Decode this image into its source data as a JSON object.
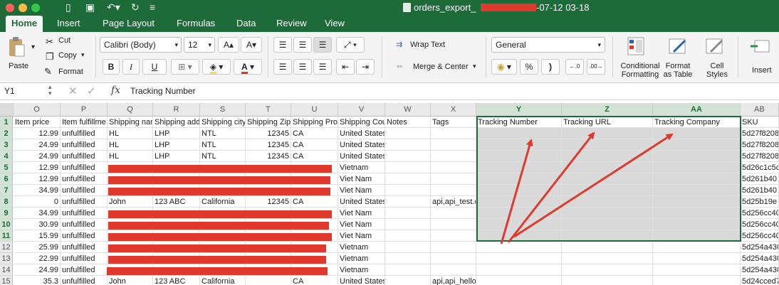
{
  "window": {
    "title": "orders_export_",
    "title_suffix": "-07-12 03-18"
  },
  "ribbon_tabs": [
    "Home",
    "Insert",
    "Page Layout",
    "Formulas",
    "Data",
    "Review",
    "View"
  ],
  "ribbon": {
    "paste": "Paste",
    "cut": "Cut",
    "copy": "Copy",
    "format": "Format",
    "font": "Calibri (Body)",
    "size": "12",
    "bold": "B",
    "italic": "I",
    "underline": "U",
    "wrap": "Wrap Text",
    "merge": "Merge & Center",
    "numformat": "General",
    "percent": "%",
    "comma": ")",
    "cond1": "Conditional",
    "cond2": "Formatting",
    "fmt1": "Format",
    "fmt2": "as Table",
    "cell1": "Cell",
    "cell2": "Styles",
    "insert": "Insert"
  },
  "formula": {
    "name": "Y1",
    "fx": "fx",
    "value": "Tracking Number"
  },
  "columns": [
    "O",
    "P",
    "Q",
    "R",
    "S",
    "T",
    "U",
    "V",
    "W",
    "X",
    "Y",
    "Z",
    "AA",
    "AB"
  ],
  "rows": [
    "1",
    "2",
    "3",
    "4",
    "5",
    "6",
    "7",
    "8",
    "9",
    "10",
    "11",
    "12",
    "13",
    "14",
    "15"
  ],
  "headers": [
    "Item price",
    "Item fulfillme",
    "Shipping nan",
    "Shipping add",
    "Shipping city",
    "Shipping Zip",
    "Shipping Pro",
    "Shipping Cou",
    "Notes",
    "Tags",
    "Tracking Number",
    "Tracking URL",
    "Tracking Company",
    "SKU"
  ],
  "table_rows": [
    [
      "12.99",
      "unfulfilled",
      "HL",
      "LHP",
      "NTL",
      "12345",
      "CA",
      "United States",
      "",
      "",
      "5d27f8208"
    ],
    [
      "24.99",
      "unfulfilled",
      "HL",
      "LHP",
      "NTL",
      "12345",
      "CA",
      "United States",
      "",
      "",
      "5d27f8208"
    ],
    [
      "24.99",
      "unfulfilled",
      "HL",
      "LHP",
      "NTL",
      "12345",
      "CA",
      "United States",
      "",
      "",
      "5d27f8208"
    ],
    [
      "12.99",
      "unfulfilled",
      "",
      "",
      "",
      "",
      "",
      "Vietnam",
      "",
      "",
      "5d26c1c5c"
    ],
    [
      "12.99",
      "unfulfilled",
      "",
      "",
      "",
      "",
      "",
      "Viet Nam",
      "",
      "",
      "5d261b40"
    ],
    [
      "34.99",
      "unfulfilled",
      "",
      "",
      "",
      "",
      "",
      "Viet Nam",
      "",
      "",
      "5d261b40"
    ],
    [
      "0",
      "unfulfilled",
      "John",
      "123 ABC",
      "California",
      "12345",
      "CA",
      "United States",
      "",
      "api,api_test.com",
      "5d25b19e"
    ],
    [
      "34.99",
      "unfulfilled",
      "",
      "",
      "",
      "",
      "",
      "Viet Nam",
      "",
      "",
      "5d256cc40"
    ],
    [
      "30.99",
      "unfulfilled",
      "",
      "",
      "",
      "",
      "",
      "Viet Nam",
      "",
      "",
      "5d256cc40"
    ],
    [
      "15.99",
      "unfulfilled",
      "",
      "",
      "",
      "",
      "",
      "Viet Nam",
      "",
      "",
      "5d256cc40"
    ],
    [
      "25.99",
      "unfulfilled",
      "",
      "",
      "",
      "",
      "",
      "Vietnam",
      "",
      "",
      "5d254a430"
    ],
    [
      "22.99",
      "unfulfilled",
      "",
      "",
      "",
      "",
      "",
      "Vietnam",
      "",
      "",
      "5d254a430"
    ],
    [
      "24.99",
      "unfulfilled",
      "",
      "",
      "",
      "",
      "",
      "Vietnam",
      "",
      "",
      "5d254a430"
    ],
    [
      "35.3",
      "unfulfilled",
      "John",
      "123 ABC",
      "California",
      "",
      "CA",
      "United States",
      "",
      "api,api_hello.com",
      "5d24cced7"
    ]
  ],
  "colors": {
    "excel_green": "#1e6b3a",
    "annotation_red": "#e03a2e",
    "selection_fill": "#d9d9d9"
  }
}
